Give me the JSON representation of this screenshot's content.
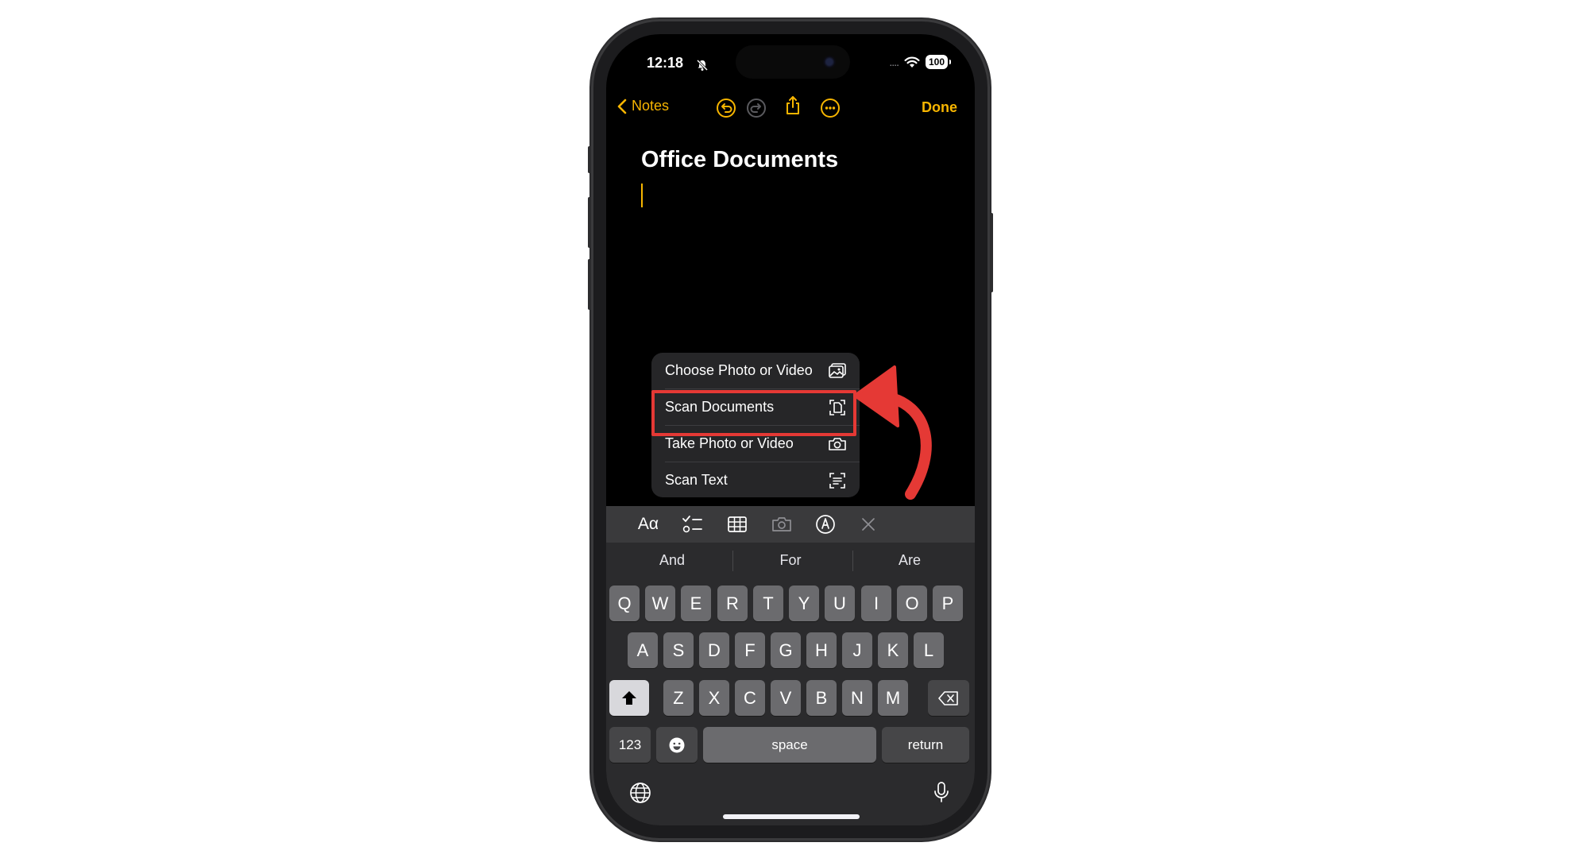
{
  "status_bar": {
    "time": "12:18",
    "signal": "....",
    "battery": "100"
  },
  "nav": {
    "back_label": "Notes",
    "done_label": "Done"
  },
  "note": {
    "title": "Office Documents"
  },
  "attach_menu": {
    "items": [
      {
        "label": "Choose Photo or Video",
        "icon": "photo-library-icon"
      },
      {
        "label": "Scan Documents",
        "icon": "doc-scan-icon"
      },
      {
        "label": "Take Photo or Video",
        "icon": "camera-icon"
      },
      {
        "label": "Scan Text",
        "icon": "text-scan-icon"
      }
    ]
  },
  "format_bar": {
    "text_format_label": "Aα"
  },
  "keyboard": {
    "suggestions": [
      "And",
      "For",
      "Are"
    ],
    "row1": [
      "Q",
      "W",
      "E",
      "R",
      "T",
      "Y",
      "U",
      "I",
      "O",
      "P"
    ],
    "row2": [
      "A",
      "S",
      "D",
      "F",
      "G",
      "H",
      "J",
      "K",
      "L"
    ],
    "row3": [
      "Z",
      "X",
      "C",
      "V",
      "B",
      "N",
      "M"
    ],
    "numbers_label": "123",
    "space_label": "space",
    "return_label": "return"
  },
  "colors": {
    "accent": "#f7b500",
    "highlight": "#e53935"
  }
}
